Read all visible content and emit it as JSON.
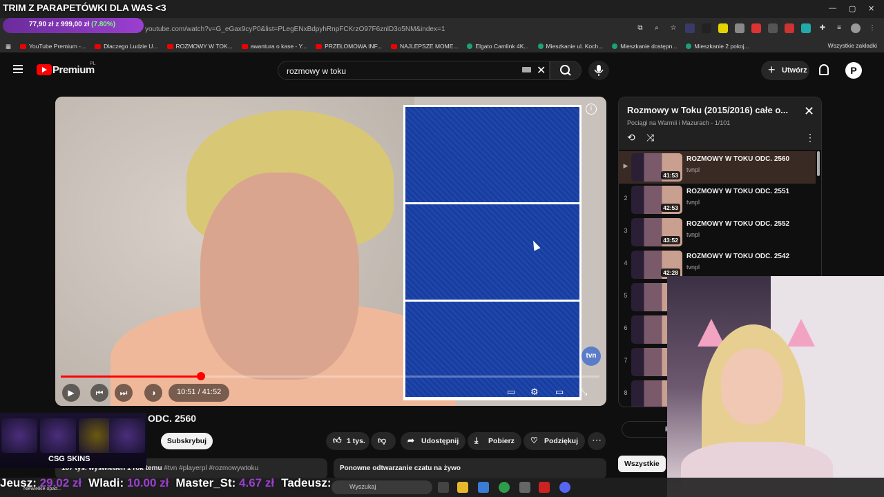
{
  "overlay": {
    "title": "TRIM Z PARAPETÓWKI DLA WAS <3",
    "donation_goal": "77,90 zł z 999,00 zł",
    "donation_pct": "(7.80%)",
    "donation_progress_pct": 7.8
  },
  "browser": {
    "url": "youtube.com/watch?v=G_eGax9cyP0&list=PLegENxBdpyhRnpFCKrzO97F6znlD3o5NM&index=1",
    "bookmarks": [
      "YouTube Premium -...",
      "Dlaczego Ludzie U...",
      "ROZMOWY W TOK...",
      "awantura o kase - Y...",
      "PRZEŁOMOWA INF...",
      "NAJLEPSZE MOME...",
      "Elgato Camlink 4K...",
      "Mieszkanie ul. Koch...",
      "Mieszkanie dostępn...",
      "Mieszkanie 2 pokoj..."
    ],
    "bookmarks_all": "Wszystkie zakładki"
  },
  "header": {
    "brand": "Premium",
    "region": "PL",
    "search_value": "rozmowy w toku",
    "create_label": "Utwórz",
    "avatar_letter": "P"
  },
  "player": {
    "time": "10:51 / 41:52",
    "progress_pct": 26,
    "channel_badge": "tvn"
  },
  "video": {
    "title_visible": "ODC. 2560",
    "subscribe": "Subskrybuj",
    "likes": "1 tys.",
    "share": "Udostępnij",
    "download": "Pobierz",
    "thanks": "Podziękuj",
    "stats": "107 tys. wyświetleń  1 rok temu",
    "tags": "#tvn #playerpl #rozmowywtoku",
    "chat_replay": "Ponowne odtwarzanie czatu na żywo",
    "filter_all": "Wszystkie"
  },
  "playlist": {
    "title": "Rozmowy w Toku (2015/2016) całe o...",
    "subtitle": "Pociągi na Warmii i Mazurach - 1/101",
    "items": [
      {
        "index": "▶",
        "title": "ROZMOWY W TOKU ODC. 2560",
        "channel": "tvnpl",
        "duration": "41:53"
      },
      {
        "index": "2",
        "title": "ROZMOWY W TOKU ODC. 2551",
        "channel": "tvnpl",
        "duration": "42:53"
      },
      {
        "index": "3",
        "title": "ROZMOWY W TOKU ODC. 2552",
        "channel": "tvnpl",
        "duration": "43:52"
      },
      {
        "index": "4",
        "title": "ROZMOWY W TOKU ODC. 2542",
        "channel": "tvnpl",
        "duration": "42:28"
      },
      {
        "index": "5",
        "title": "",
        "channel": "",
        "duration": "4"
      },
      {
        "index": "6",
        "title": "",
        "channel": "",
        "duration": "4"
      },
      {
        "index": "7",
        "title": "",
        "channel": "",
        "duration": "4"
      },
      {
        "index": "8",
        "title": "",
        "channel": "",
        "duration": "4"
      }
    ]
  },
  "skins": {
    "brand": "CSG SKINS"
  },
  "ticker": [
    {
      "name": "Jeusz:",
      "amount": "29.02 zł"
    },
    {
      "name": "Wladi:",
      "amount": "10.00 zł"
    },
    {
      "name": "Master_St:",
      "amount": "4.67 zł"
    },
    {
      "name": "Tadeusz:",
      "amount": ""
    }
  ],
  "taskbar": {
    "search_placeholder": "Wyszukaj",
    "note": "Niewielkie opad..."
  }
}
